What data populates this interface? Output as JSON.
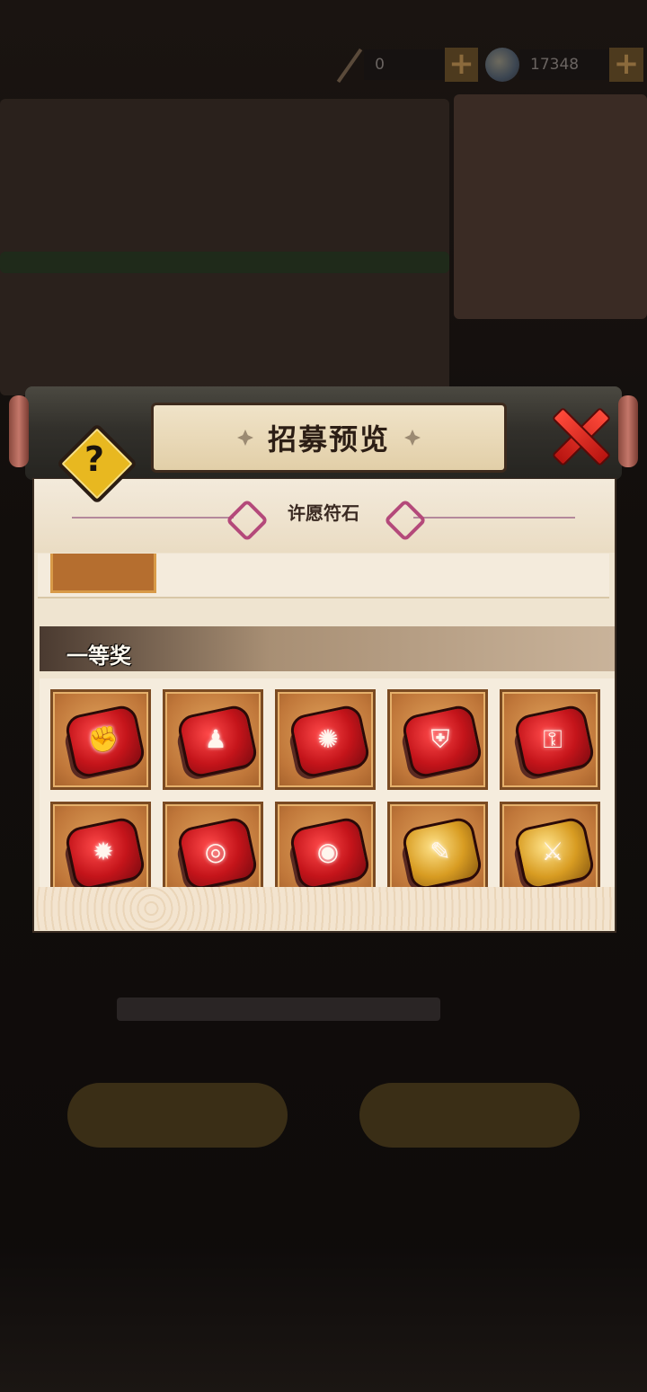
{
  "currency": {
    "items": [
      {
        "icon": "scroll-pen-icon",
        "value": "0"
      },
      {
        "icon": "gem-icon",
        "value": "17348"
      }
    ]
  },
  "modal": {
    "title": "招募预览",
    "subtitle": "许愿符石",
    "tier_label": "一等奖",
    "help_symbol": "?"
  },
  "rewards": [
    {
      "icon": "fist-rune-icon",
      "color": "red",
      "glyph": "✊"
    },
    {
      "icon": "figure-rune-icon",
      "color": "red",
      "glyph": "♟"
    },
    {
      "icon": "flame-rune-icon",
      "color": "red",
      "glyph": "✺"
    },
    {
      "icon": "shield-rune-icon",
      "color": "red",
      "glyph": "⛨"
    },
    {
      "icon": "scroll-rune-icon",
      "color": "red",
      "glyph": "⚿"
    },
    {
      "icon": "impact-fist-rune-icon",
      "color": "red",
      "glyph": "✹"
    },
    {
      "icon": "target-rune-icon",
      "color": "red",
      "glyph": "◎"
    },
    {
      "icon": "eye-rune-icon",
      "color": "red",
      "glyph": "◉"
    },
    {
      "icon": "brush-rune-icon",
      "color": "gold",
      "glyph": "✎"
    },
    {
      "icon": "sword-rune-icon",
      "color": "gold",
      "glyph": "⚔"
    }
  ],
  "colors": {
    "accent_red": "#c4141a",
    "accent_gold": "#d89c22",
    "paper": "#efe4d0"
  }
}
